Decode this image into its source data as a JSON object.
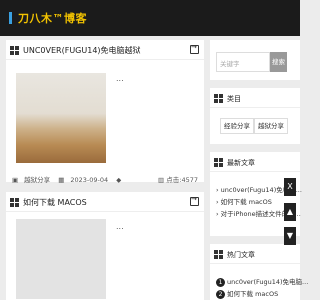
{
  "site": {
    "title": "刀八木™博客"
  },
  "posts": [
    {
      "title": "UNC0VER(FUGU14)免电脑越狱",
      "excerpt": "...",
      "category": "越狱分享",
      "date": "2023-09-04",
      "views": "点击:4577"
    },
    {
      "title": "如何下载 MACOS",
      "excerpt": "..."
    }
  ],
  "sidebar": {
    "search_placeholder": "关键字",
    "search_button": "搜索",
    "categories_title": "类目",
    "categories": [
      "经验分享",
      "越狱分享"
    ],
    "latest_title": "最新文章",
    "latest": [
      "unc0ver(Fugu14)免电脑...",
      "如何下载 macOS",
      "对于iPhone描述文件的签..."
    ],
    "hot_title": "热门文章",
    "hot": [
      {
        "num": "1",
        "text": "unc0ver(Fugu14)免电脑..."
      },
      {
        "num": "2",
        "text": "如何下载 macOS"
      }
    ]
  },
  "floating": {
    "close": "X",
    "up": "▲",
    "down": "▼"
  }
}
